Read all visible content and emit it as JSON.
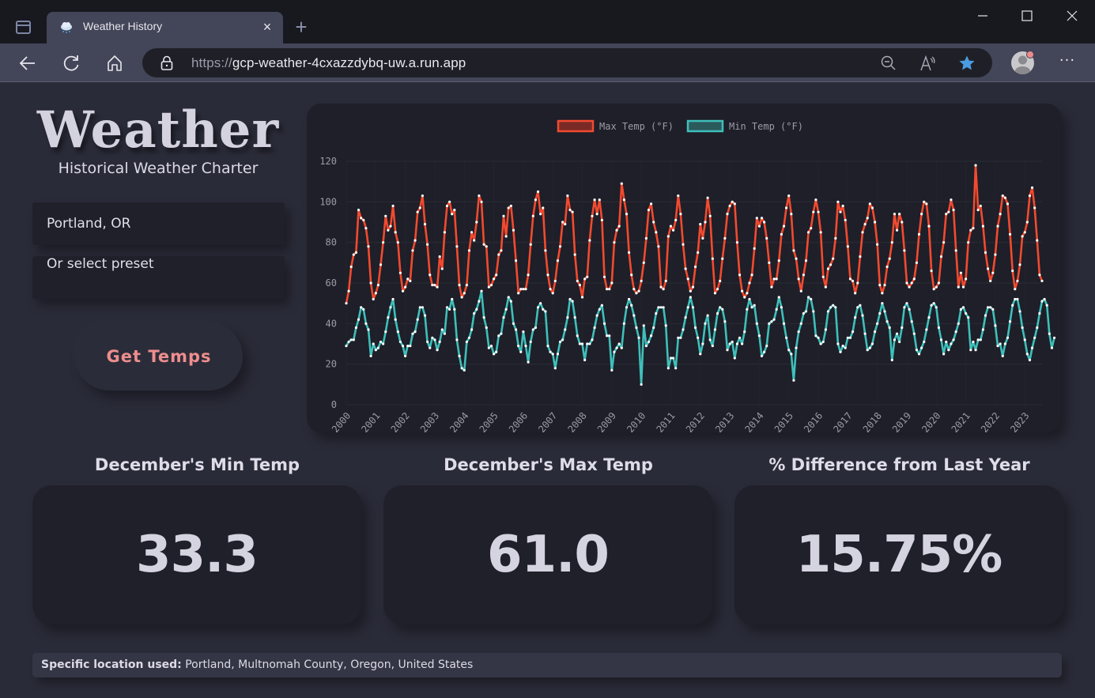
{
  "browser": {
    "tab_title": "Weather History",
    "tab_close": "×",
    "new_tab": "+",
    "url_scheme": "https://",
    "url_host": "gcp-weather-4cxazzdybq-uw.a.run.app",
    "more_label": "···"
  },
  "header": {
    "title": "Weather",
    "subtitle": "Historical Weather Charter"
  },
  "form": {
    "location_value": "Portland, OR",
    "preset_placeholder": "Or select preset",
    "submit_label": "Get Temps"
  },
  "stats": [
    {
      "title": "December's Min Temp",
      "value": "33.3"
    },
    {
      "title": "December's Max Temp",
      "value": "61.0"
    },
    {
      "title": "% Difference from Last Year",
      "value": "15.75%"
    }
  ],
  "footer": {
    "label": "Specific location used:",
    "value": "Portland, Multnomah County, Oregon, United States"
  },
  "colors": {
    "max_line": "#f24a2f",
    "max_fill": "#7a2a26",
    "min_line": "#3fbfbb",
    "min_fill": "#2b5a5c",
    "accent": "#ee8e8e",
    "star": "#4a9de0"
  },
  "chart_data": {
    "type": "line",
    "title": "",
    "xlabel": "",
    "ylabel": "",
    "ylim": [
      0,
      120
    ],
    "yticks": [
      "0",
      "20",
      "40",
      "60",
      "80",
      "100",
      "120"
    ],
    "x_tick_labels": [
      "2000",
      "2001",
      "2002",
      "2003",
      "2004",
      "2005",
      "2006",
      "2007",
      "2008",
      "2009",
      "2010",
      "2011",
      "2012",
      "2013",
      "2014",
      "2015",
      "2016",
      "2017",
      "2018",
      "2019",
      "2020",
      "2021",
      "2022",
      "2023"
    ],
    "x_unit": "month",
    "legend": [
      "Max Temp (°F)",
      "Min Temp (°F)"
    ],
    "legend_position": "top-center",
    "grid": true,
    "series": [
      {
        "name": "Max Temp (°F)",
        "values": [
          50,
          56,
          68,
          74,
          75,
          96,
          92,
          91,
          87,
          78,
          60,
          52,
          55,
          59,
          69,
          80,
          93,
          86,
          88,
          98,
          85,
          80,
          65,
          56,
          58,
          62,
          61,
          76,
          81,
          95,
          97,
          103,
          89,
          79,
          64,
          59,
          59,
          58,
          73,
          67,
          85,
          98,
          100,
          94,
          96,
          78,
          59,
          53,
          55,
          59,
          76,
          85,
          81,
          90,
          103,
          100,
          79,
          78,
          58,
          59,
          62,
          64,
          74,
          76,
          93,
          83,
          97,
          98,
          86,
          71,
          55,
          57,
          57,
          57,
          64,
          79,
          93,
          101,
          105,
          94,
          97,
          76,
          64,
          57,
          55,
          61,
          71,
          78,
          90,
          89,
          103,
          96,
          95,
          74,
          61,
          59,
          53,
          62,
          63,
          81,
          93,
          101,
          94,
          101,
          91,
          63,
          57,
          57,
          60,
          80,
          86,
          88,
          109,
          101,
          94,
          75,
          64,
          57,
          55,
          56,
          61,
          70,
          82,
          96,
          99,
          90,
          85,
          78,
          58,
          57,
          61,
          83,
          88,
          86,
          91,
          103,
          94,
          79,
          67,
          62,
          56,
          58,
          68,
          75,
          89,
          82,
          90,
          102,
          93,
          72,
          55,
          57,
          61,
          72,
          82,
          94,
          98,
          100,
          99,
          80,
          64,
          56,
          53,
          55,
          60,
          64,
          77,
          92,
          88,
          92,
          90,
          82,
          70,
          58,
          62,
          62,
          71,
          84,
          88,
          97,
          103,
          94,
          76,
          72,
          62,
          56,
          64,
          71,
          85,
          87,
          95,
          101,
          95,
          85,
          63,
          58,
          67,
          69,
          72,
          82,
          100,
          95,
          98,
          91,
          78,
          62,
          61,
          55,
          60,
          73,
          85,
          89,
          92,
          99,
          97,
          90,
          79,
          59,
          55,
          59,
          68,
          72,
          80,
          94,
          86,
          94,
          90,
          76,
          60,
          58,
          60,
          62,
          70,
          84,
          94,
          100,
          99,
          88,
          66,
          57,
          58,
          60,
          73,
          80,
          94,
          95,
          101,
          96,
          76,
          58,
          65,
          58,
          62,
          80,
          86,
          87,
          118,
          96,
          98,
          88,
          75,
          67,
          61,
          65,
          74,
          88,
          94,
          103,
          102,
          99,
          84,
          66,
          57,
          61,
          69,
          83,
          85,
          90,
          103,
          107,
          97,
          81,
          64,
          61
        ]
      },
      {
        "name": "Min Temp (°F)",
        "values": [
          29,
          31,
          32,
          32,
          38,
          42,
          48,
          47,
          40,
          37,
          24,
          30,
          27,
          28,
          31,
          30,
          36,
          43,
          48,
          52,
          42,
          36,
          31,
          29,
          24,
          29,
          29,
          35,
          36,
          42,
          48,
          48,
          44,
          31,
          28,
          33,
          32,
          27,
          31,
          37,
          35,
          48,
          47,
          52,
          47,
          32,
          24,
          18,
          17,
          31,
          33,
          37,
          45,
          47,
          51,
          56,
          43,
          38,
          28,
          29,
          25,
          26,
          34,
          35,
          43,
          47,
          53,
          51,
          40,
          37,
          29,
          26,
          36,
          29,
          21,
          31,
          37,
          38,
          48,
          50,
          47,
          46,
          29,
          26,
          25,
          18,
          25,
          31,
          32,
          37,
          43,
          52,
          51,
          43,
          34,
          30,
          30,
          22,
          30,
          30,
          32,
          38,
          44,
          47,
          49,
          40,
          34,
          34,
          17,
          26,
          28,
          30,
          28,
          40,
          48,
          52,
          49,
          44,
          38,
          33,
          10,
          39,
          29,
          31,
          34,
          38,
          45,
          48,
          48,
          48,
          39,
          18,
          23,
          23,
          18,
          33,
          33,
          37,
          43,
          48,
          53,
          48,
          38,
          33,
          25,
          30,
          40,
          44,
          32,
          29,
          37,
          45,
          48,
          47,
          41,
          27,
          30,
          31,
          23,
          30,
          33,
          30,
          36,
          47,
          52,
          48,
          49,
          40,
          34,
          24,
          26,
          29,
          40,
          41,
          42,
          47,
          53,
          48,
          40,
          33,
          27,
          25,
          12,
          28,
          36,
          40,
          45,
          46,
          53,
          52,
          46,
          34,
          33,
          30,
          31,
          37,
          46,
          48,
          49,
          48,
          30,
          26,
          29,
          28,
          33,
          33,
          36,
          43,
          48,
          49,
          44,
          35,
          27,
          28,
          30,
          36,
          40,
          45,
          50,
          46,
          41,
          38,
          22,
          32,
          35,
          31,
          38,
          48,
          50,
          47,
          41,
          35,
          27,
          25,
          28,
          31,
          37,
          43,
          49,
          50,
          48,
          38,
          32,
          25,
          31,
          27,
          30,
          32,
          36,
          40,
          47,
          48,
          45,
          43,
          27,
          31,
          27,
          32,
          32,
          37,
          44,
          48,
          48,
          47,
          39,
          29,
          30,
          24,
          30,
          33,
          41,
          49,
          52,
          52,
          46,
          38,
          32,
          25,
          22,
          28,
          33,
          38,
          45,
          51,
          52,
          49,
          35,
          28,
          33
        ]
      }
    ]
  }
}
